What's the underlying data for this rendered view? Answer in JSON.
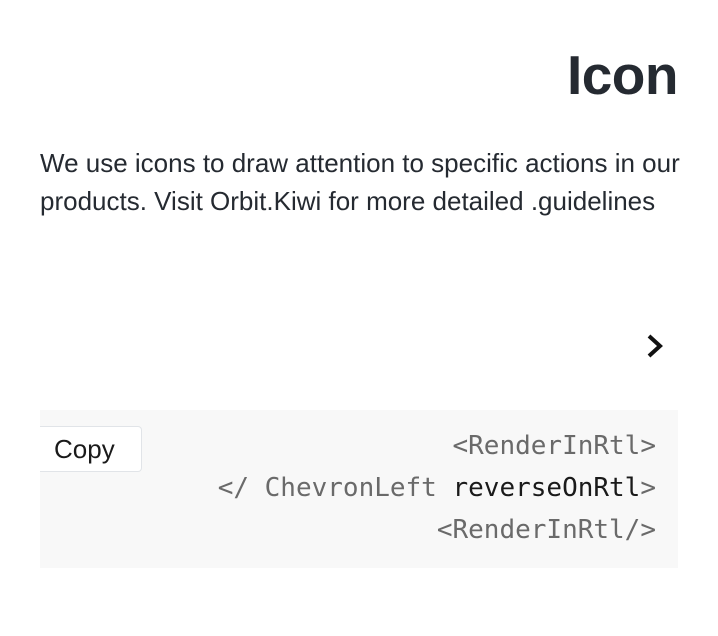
{
  "page": {
    "title": "Icon",
    "description": "We use icons to draw attention to specific actions in our products. Visit Orbit.Kiwi for more detailed .guidelines"
  },
  "preview": {
    "icon": "chevron-right-icon"
  },
  "code": {
    "copy_label": "Copy",
    "line1": "<RenderInRtl>",
    "line2_prefix": "</ ChevronLeft ",
    "line2_attr": "reverseOnRtl",
    "line2_suffix": ">",
    "line3": "<RenderInRtl/>"
  },
  "colors": {
    "text": "#252a31",
    "code_background": "#f8f8f8",
    "code_text": "#6a6a6a",
    "code_attribute": "#1a1a1a"
  }
}
